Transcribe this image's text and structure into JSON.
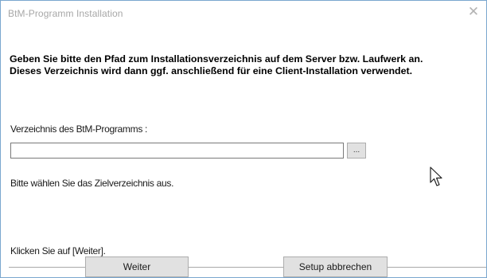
{
  "window": {
    "title": "BtM-Programm Installation",
    "close_glyph": "✕"
  },
  "instructions": {
    "line1": "Geben Sie bitte den Pfad zum Installationsverzeichnis auf dem Server bzw. Laufwerk an.",
    "line2": "Dieses Verzeichnis wird dann ggf. anschließend für eine Client-Installation verwendet."
  },
  "directory": {
    "label": "Verzeichnis des BtM-Programms :",
    "value": "",
    "browse_label": "..."
  },
  "hint": "Bitte wählen Sie das Zielverzeichnis aus.",
  "footer_hint": "Klicken Sie auf [Weiter].",
  "buttons": {
    "next_label": "Weiter",
    "cancel_label": "Setup abbrechen"
  },
  "icons": {
    "close": "close-icon",
    "cursor": "mouse-pointer-icon"
  }
}
